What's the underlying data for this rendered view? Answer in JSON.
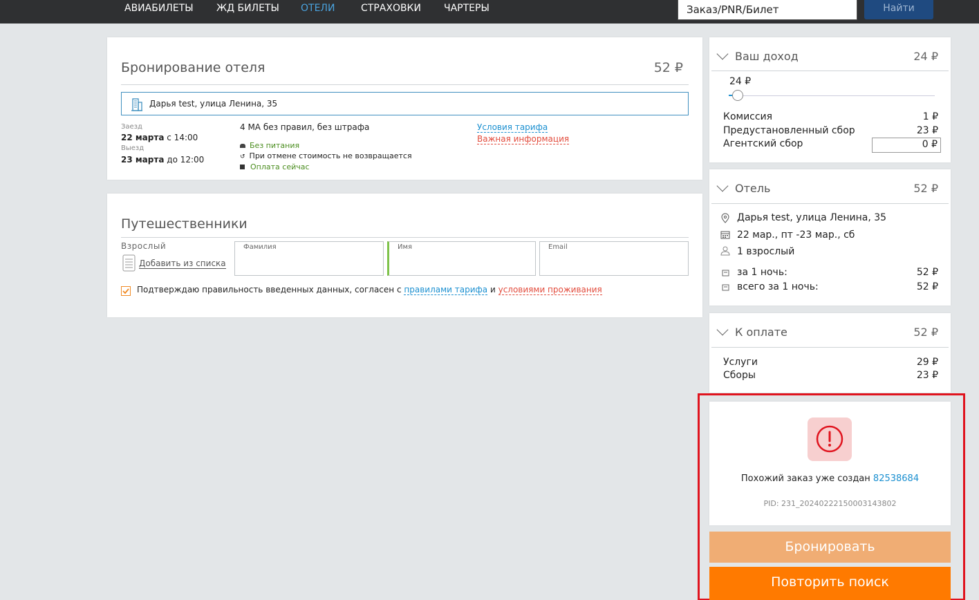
{
  "nav": {
    "items": [
      "АВИАБИЛЕТЫ",
      "ЖД БИЛЕТЫ",
      "ОТЕЛИ",
      "СТРАХОВКИ",
      "ЧАРТЕРЫ"
    ],
    "active": "ОТЕЛИ",
    "search_value": "Заказ/PNR/Билет",
    "search_button": "Найти"
  },
  "booking": {
    "title": "Бронирование отеля",
    "price": "52 ₽",
    "hotel": "Дарья test, улица Ленина, 35",
    "checkin_label": "Заезд",
    "checkin_date": "22 марта",
    "checkin_time": "с 14:00",
    "checkout_label": "Выезд",
    "checkout_date": "23 марта",
    "checkout_time": "до 12:00",
    "room": "4 МА без правил, без штрафа",
    "meal": "Без питания",
    "cancel": "При отмене стоимость не возвращается",
    "payment": "Оплата сейчас",
    "tariff_link": "Условия тарифа",
    "important_link": "Важная информация"
  },
  "travelers": {
    "title": "Путешественники",
    "type": "Взрослый",
    "add_from_list": "Добавить из списка",
    "surname": "Фамилия",
    "name": "Имя",
    "email": "Email",
    "confirm_text": "Подтверждаю правильность введенных данных, согласен с",
    "rules_link": "правилами тарифа",
    "and": "и",
    "stay_link": "условиями проживания"
  },
  "income": {
    "title": "Ваш доход",
    "amount": "24 ₽",
    "slider_value": "24 ₽",
    "commission_label": "Комиссия",
    "commission": "1 ₽",
    "preset_fee_label": "Предустановленный сбор",
    "preset_fee": "23 ₽",
    "agent_fee_label": "Агентский сбор",
    "agent_fee": "0 ₽"
  },
  "hotel_summary": {
    "title": "Отель",
    "amount": "52 ₽",
    "address": "Дарья test, улица Ленина, 35",
    "dates": "22 мар., пт -23 мар., сб",
    "guests": "1 взрослый",
    "per_night_label": "за 1 ночь:",
    "per_night": "52 ₽",
    "total_label": "всего за 1 ночь:",
    "total": "52 ₽"
  },
  "payment_summary": {
    "title": "К оплате",
    "amount": "52 ₽",
    "services_label": "Услуги",
    "services": "29 ₽",
    "fees_label": "Сборы",
    "fees": "23 ₽"
  },
  "alert": {
    "message": "Похожий заказ уже создан",
    "order_number": "82538684",
    "pid": "PID: 231_20240222150003143802"
  },
  "actions": {
    "book": "Бронировать",
    "repeat": "Повторить поиск"
  },
  "colors": {
    "accent_blue": "#1a8fd0",
    "orange": "#ff7a00",
    "alert_red": "#e0141e"
  }
}
